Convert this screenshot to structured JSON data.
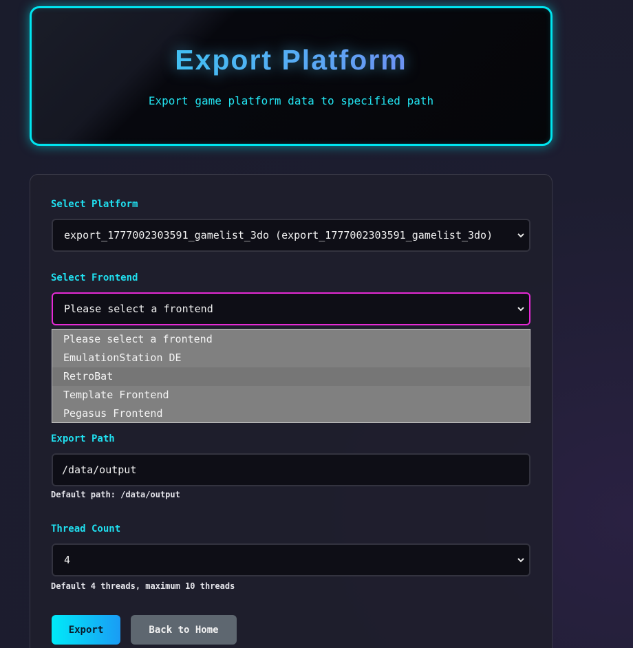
{
  "header": {
    "title": "Export Platform",
    "subtitle": "Export game platform data to specified path"
  },
  "form": {
    "platform": {
      "label": "Select Platform",
      "selected": "export_1777002303591_gamelist_3do (export_1777002303591_gamelist_3do)"
    },
    "frontend": {
      "label": "Select Frontend",
      "selected": "Please select a frontend",
      "options": [
        "Please select a frontend",
        "EmulationStation DE",
        "RetroBat",
        "Template Frontend",
        "Pegasus Frontend"
      ],
      "highlighted_option": "RetroBat"
    },
    "export_path": {
      "label": "Export Path",
      "value": "/data/output",
      "hint": "Default path: /data/output"
    },
    "thread_count": {
      "label": "Thread Count",
      "selected": "4",
      "hint": "Default 4 threads, maximum 10 threads"
    }
  },
  "buttons": {
    "export_label": "Export",
    "back_label": "Back to Home"
  },
  "colors": {
    "accent_cyan": "#00e5f0",
    "focus_magenta": "#e62ad6",
    "background": "#1d1d30"
  }
}
